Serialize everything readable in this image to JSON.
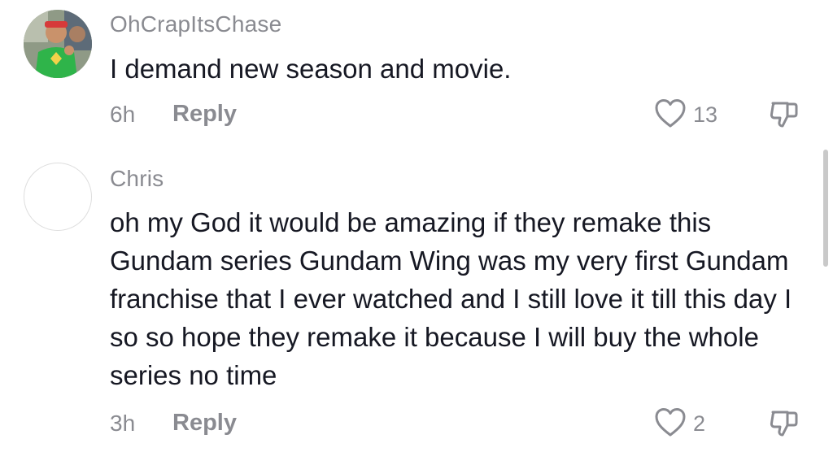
{
  "comments": [
    {
      "username": "OhCrapItsChase",
      "text": "I demand new season and movie.",
      "time": "6h",
      "reply_label": "Reply",
      "likes": "13",
      "avatar": "profile-photo"
    },
    {
      "username": "Chris",
      "text": "oh my God it would be amazing if they remake this Gundam series Gundam Wing was my very first Gundam franchise that I ever watched and I still love it till this day I so so hope they remake it because I will buy the whole series no time",
      "time": "3h",
      "reply_label": "Reply",
      "likes": "2",
      "avatar": "blank"
    }
  ],
  "icons": {
    "like": "heart-outline-icon",
    "dislike": "thumbs-down-icon"
  },
  "colors": {
    "text": "#161823",
    "secondary": "#8a8b91"
  }
}
